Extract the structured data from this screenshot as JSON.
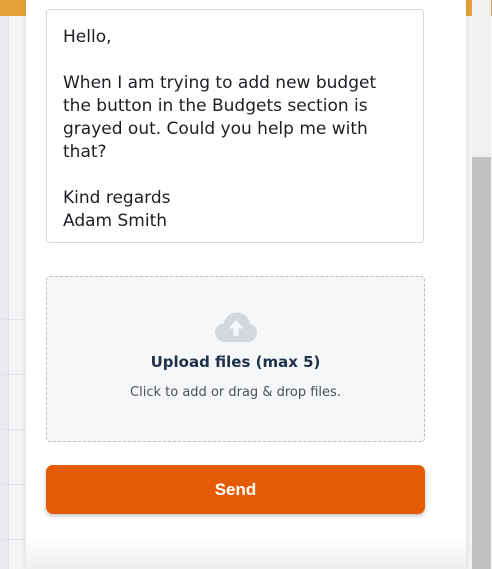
{
  "message": {
    "text": "Hello,\n\nWhen I am trying to add new budget the button in the Budgets section is grayed out. Could you help me with that?\n\nKind regards\nAdam Smith"
  },
  "upload": {
    "icon": "cloud-upload-icon",
    "title": "Upload files (max 5)",
    "hint": "Click to add or drag & drop files."
  },
  "send_button": {
    "label": "Send"
  },
  "colors": {
    "accent": "#e45a05",
    "top_bar": "#e4a23c",
    "icon_gray": "#d4d8dd",
    "upload_title": "#20324a"
  }
}
